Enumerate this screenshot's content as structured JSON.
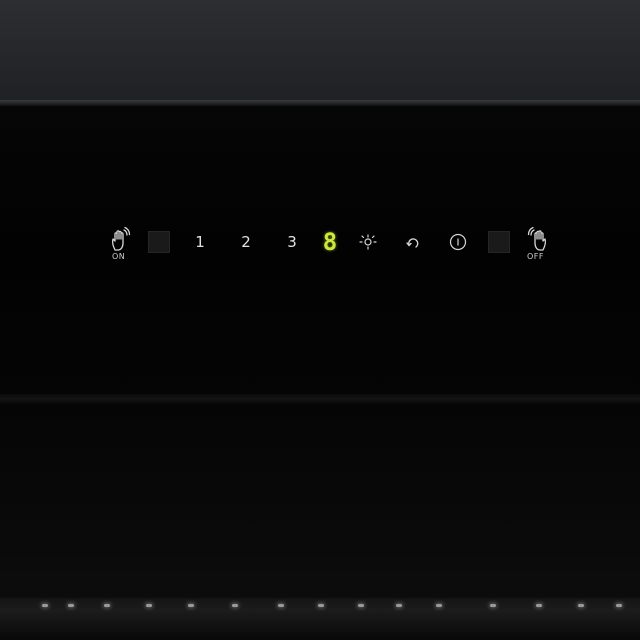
{
  "panel": {
    "on_label": "ON",
    "off_label": "OFF",
    "speeds": [
      "1",
      "2",
      "3"
    ],
    "display_value": "8"
  },
  "icons": {
    "on_gesture": "hand-wave-icon",
    "off_gesture": "hand-wave-icon",
    "light": "light-bulb-icon",
    "timer": "delay-timer-icon",
    "power": "power-icon"
  },
  "colors": {
    "display_green": "#cde83a",
    "glass": "#030303",
    "wall": "#28292c"
  }
}
